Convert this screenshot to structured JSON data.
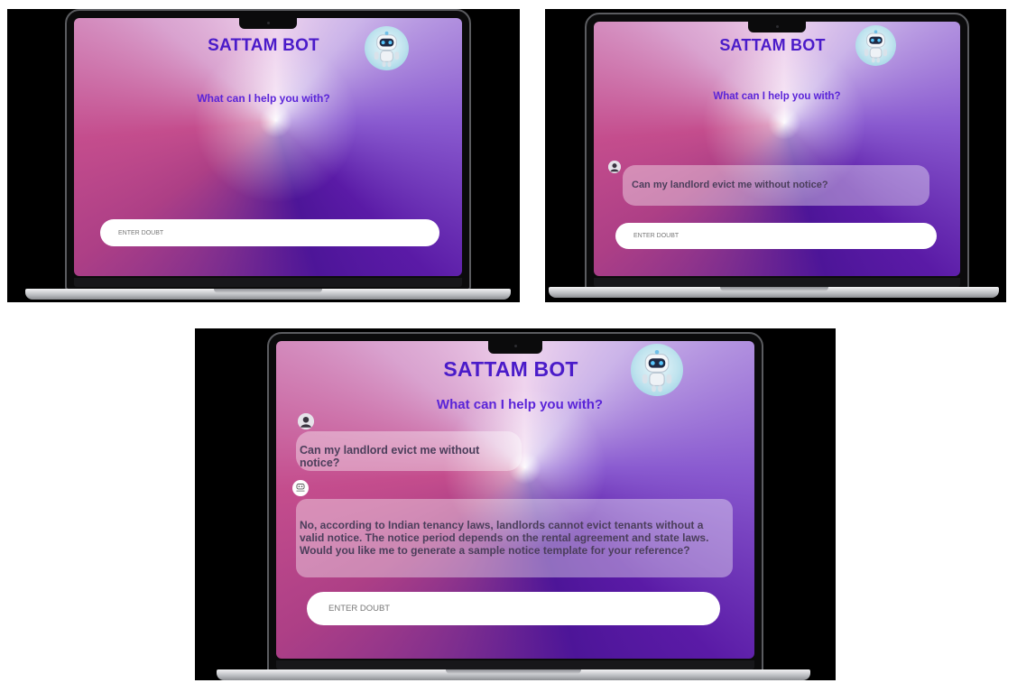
{
  "app": {
    "title": "SATTAM BOT",
    "subtitle": "What can I help you with?",
    "input_placeholder": "ENTER DOUBT"
  },
  "chat": {
    "user_message": "Can my landlord evict me without notice?",
    "bot_reply": "No, according to Indian tenancy laws, landlords cannot evict tenants without a valid notice. The notice period depends on the rental agreement and state laws. Would you like me to generate a sample notice template for your reference?"
  },
  "icons": {
    "bot": "robot-icon",
    "user": "user-icon",
    "bot_small": "robot-small-icon"
  },
  "colors": {
    "title": "#4a1bc9",
    "subtitle": "#5a24d8",
    "input_bg": "#ffffff"
  }
}
